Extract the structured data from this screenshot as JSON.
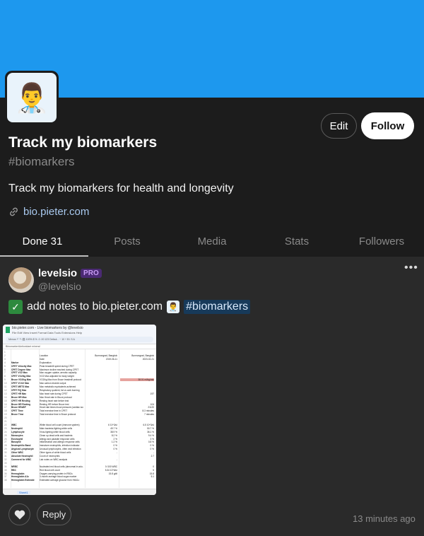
{
  "banner": {
    "color": "#1d98ee"
  },
  "profile": {
    "avatar_icon": "doctor-emoji",
    "avatar_glyph": "👨‍⚕️",
    "title": "Track my biomarkers",
    "handle": "#biomarkers",
    "bio": "Track my biomarkers for health and longevity",
    "link_icon": "link-icon",
    "link": "bio.pieter.com",
    "edit_label": "Edit",
    "follow_label": "Follow"
  },
  "tabs": [
    {
      "label": "Done 31",
      "active": true
    },
    {
      "label": "Posts",
      "active": false
    },
    {
      "label": "Media",
      "active": false
    },
    {
      "label": "Stats",
      "active": false
    },
    {
      "label": "Followers",
      "active": false
    }
  ],
  "post": {
    "author": "levelsio",
    "badge": "PRO",
    "handle": "@levelsio",
    "more": "•••",
    "check_glyph": "✓",
    "text": "add notes to bio.pieter.com",
    "mini_glyph": "👨‍⚕️",
    "hashtag": "#biomarkers",
    "reply_label": "Reply",
    "like_icon": "heart-icon",
    "time": "13 minutes ago"
  },
  "sheet": {
    "doc_title": "bio.pieter.com - Live biomarkers by @levelsio",
    "menu": "File  Edit  View  Insert  Format  Data  Tools  Extensions  Help",
    "toolbar": "Menus  ↶  ↷  🖨  100%  $  %  .0  .00  123  Defaul...  −  10  +  B  I  S  A",
    "formula": "Bbiomarker/Antioxidant mineral",
    "sheet_tab": "Sheet1",
    "rows": [
      {
        "n": "1",
        "a": "",
        "b": "",
        "c": "",
        "d": ""
      },
      {
        "n": "2",
        "a": "",
        "b": "Location",
        "c": "Bumrungrad, Bangkok",
        "d": "Bumrungrad, Bangkok"
      },
      {
        "n": "3",
        "a": "",
        "b": "Date",
        "c": "2019-06-11",
        "d": "2023-02-21"
      },
      {
        "n": "4",
        "a": "Marker",
        "b": "Explanation",
        "c": "",
        "d": ""
      },
      {
        "n": "5",
        "a": "CPET Velocity Max",
        "b": "Peak treadmill speed during CPET",
        "c": "",
        "d": ""
      },
      {
        "n": "6",
        "a": "CPET Degree Max",
        "b": "Maximum incline reached during CPET",
        "c": "",
        "d": ""
      },
      {
        "n": "7",
        "a": "CPET VO2 Max",
        "b": "Max oxygen uptake, aerobic capacity",
        "c": "",
        "d": ""
      },
      {
        "n": "8",
        "a": "CPET VO2/kg Max",
        "b": "VO2 Max adjusted for body weight",
        "c": "",
        "d": ""
      },
      {
        "n": "9",
        "a": "Bruce VO2/kg Max",
        "b": "VO2/kg Max from Bruce treadmill protocol",
        "c": "",
        "d": ""
      },
      {
        "n": "10",
        "a": "CPET VCO2 Max",
        "b": "Max carbon dioxide output",
        "c": "",
        "d": ""
      },
      {
        "n": "11",
        "a": "CPET METS Max",
        "b": "Max metabolic equivalents achieved",
        "c": "",
        "d": ""
      },
      {
        "n": "12",
        "a": "CPET RQ Max",
        "b": "Respiratory quotient, fat vs carb burning",
        "c": "",
        "d": ""
      },
      {
        "n": "13",
        "a": "CPET HR Max",
        "b": "Max heart rate during CPET",
        "c": "",
        "d": "197"
      },
      {
        "n": "14",
        "a": "Bruce HR Max",
        "b": "Max Heart rate in Bruce protocol",
        "c": "",
        "d": ""
      },
      {
        "n": "15",
        "a": "CPET HR Resting",
        "b": "Resting heart rate before test",
        "c": "",
        "d": ""
      },
      {
        "n": "16",
        "a": "Bruce HR Resting",
        "b": "Resting HR before Bruce test",
        "c": "",
        "d": "104"
      },
      {
        "n": "17",
        "a": "Bruce HRxBP",
        "b": "Heart rate times blood pressure (cardiac wo...",
        "c": "",
        "d": "21120"
      },
      {
        "n": "18",
        "a": "CPET Time",
        "b": "Total exercise time in CPET",
        "c": "",
        "d": "8.3 minutes"
      },
      {
        "n": "19",
        "a": "Bruce Time",
        "b": "Total exercise time in Bruce protocol",
        "c": "",
        "d": "7 minutes"
      },
      {
        "n": "20",
        "a": "",
        "b": "",
        "c": "",
        "d": ""
      },
      {
        "n": "21",
        "a": "",
        "b": "",
        "c": "",
        "d": ""
      },
      {
        "n": "22",
        "a": "WBC",
        "b": "White blood cell count (immune system)",
        "c": "6  10^3/ul",
        "d": "6.5  10^3/ul"
      },
      {
        "n": "23",
        "a": "Neutrophil",
        "b": "Main bacteria-fighting white cells",
        "c": "49.7  %",
        "d": "50.7  %"
      },
      {
        "n": "24",
        "a": "Lymphocyte",
        "b": "Virus-fighting white blood cells",
        "c": "38.9  %",
        "d": "36.1  %"
      },
      {
        "n": "25",
        "a": "Monocytes",
        "b": "Clean up dead cells and bacteria",
        "c": "8.2  %",
        "d": "9.4  %"
      },
      {
        "n": "26",
        "a": "Eosinophil",
        "b": "Allergy and parasite response cells",
        "c": "2  %",
        "d": "3  %"
      },
      {
        "n": "27",
        "a": "Basophil",
        "b": "Inflammation and allergic response cells",
        "c": "1.2  %",
        "d": "0.8  %"
      },
      {
        "n": "28",
        "a": "Neutrophilic Band",
        "b": "Immature neutrophils, infection indicator",
        "c": "0  %",
        "d": "0  %"
      },
      {
        "n": "29",
        "a": "Atypical Lymphocyte",
        "b": "Unusual lymphocytes, often viral infection",
        "c": "0  %",
        "d": "0  %"
      },
      {
        "n": "30",
        "a": "Other WBC",
        "b": "Other types of white blood cells",
        "c": "-",
        "d": "-"
      },
      {
        "n": "31",
        "a": "Absolute Neutrophil",
        "b": "Count of neutrophils",
        "c": "",
        "d": "2.7"
      },
      {
        "n": "32",
        "a": "Comment for WBC",
        "b": "Lab notes on WBC analysis",
        "c": "-",
        "d": ""
      },
      {
        "n": "33",
        "a": "",
        "b": "",
        "c": "",
        "d": ""
      },
      {
        "n": "34",
        "a": "NRBC",
        "b": "Nucleated red blood cells (abnormal in adu...",
        "c": "0  /100 WBC",
        "d": "0"
      },
      {
        "n": "35",
        "a": "RBC",
        "b": "Red blood cell count",
        "c": "5.34  10^6/ul",
        "d": "5"
      },
      {
        "n": "36",
        "a": "Hemoglobin",
        "b": "Oxygen-carrying protein in RBCs",
        "c": "15.8  g/dl",
        "d": "15.8"
      },
      {
        "n": "37",
        "a": "Hemoglobin A1c",
        "b": "3-month average blood sugar marker",
        "c": "",
        "d": "5.1"
      },
      {
        "n": "38",
        "a": "Hemoglobin Estimate",
        "b": "Estimated average glucose from HbA1c",
        "c": "",
        "d": ""
      }
    ],
    "highlight_row": "9",
    "highlight_value": "38.01 ml/kg/min"
  }
}
